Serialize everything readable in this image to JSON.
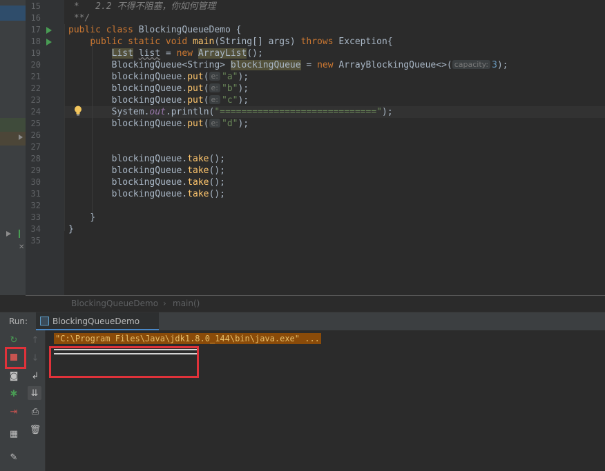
{
  "editor": {
    "line_numbers": [
      "15",
      "16",
      "17",
      "18",
      "19",
      "20",
      "21",
      "22",
      "23",
      "24",
      "25",
      "26",
      "27",
      "28",
      "29",
      "30",
      "31",
      "32",
      "33",
      "34",
      "35"
    ],
    "comment_line_1": " *   2.2 不得不阻塞，你如何管理",
    "comment_line_2": " **/",
    "class_decl": {
      "kw": "public class ",
      "name": "BlockingQueueDemo",
      "brace": " {"
    },
    "main_decl": {
      "kw1": "public static void ",
      "name": "main",
      "params": "(String[] args) ",
      "throws": "throws ",
      "exc": "Exception",
      "brace": "{"
    },
    "line19": {
      "type": "List",
      "sp": " ",
      "var": "list",
      "eq": " = ",
      "new": "new ",
      "cls": "ArrayList",
      "end": "();"
    },
    "line20": {
      "type": "BlockingQueue",
      "gen": "<String>",
      "sp": " ",
      "var": "blockingQueue",
      "eq": " = ",
      "new": "new ",
      "cls": "ArrayBlockingQueue",
      "gen2": "<>(",
      "hint": "capacity:",
      "num": "3",
      "end": ");"
    },
    "line21": {
      "obj": "blockingQueue",
      "dot": ".",
      "m": "put",
      "open": "(",
      "hint": "e:",
      "arg": "\"a\"",
      "end": ");"
    },
    "line22": {
      "obj": "blockingQueue",
      "dot": ".",
      "m": "put",
      "open": "(",
      "hint": "e:",
      "arg": "\"b\"",
      "end": ");"
    },
    "line23": {
      "obj": "blockingQueue",
      "dot": ".",
      "m": "put",
      "open": "(",
      "hint": "e:",
      "arg": "\"c\"",
      "end": ");"
    },
    "line24": {
      "sys": "System",
      "dot": ".",
      "out": "out",
      "dot2": ".",
      "m": "println",
      "open": "(",
      "arg": "\"=============================\"",
      "end": ");"
    },
    "line25": {
      "obj": "blockingQueue",
      "dot": ".",
      "m": "put",
      "open": "(",
      "hint": "e:",
      "arg": "\"d\"",
      "end": ");"
    },
    "take_lines": [
      {
        "obj": "blockingQueue",
        "dot": ".",
        "m": "take",
        "end": "();"
      },
      {
        "obj": "blockingQueue",
        "dot": ".",
        "m": "take",
        "end": "();"
      },
      {
        "obj": "blockingQueue",
        "dot": ".",
        "m": "take",
        "end": "();"
      },
      {
        "obj": "blockingQueue",
        "dot": ".",
        "m": "take",
        "end": "();"
      }
    ],
    "close_brace_inner": "}",
    "close_brace_outer": "}"
  },
  "breadcrumb": {
    "class": "BlockingQueueDemo",
    "sep": "›",
    "method": "main()"
  },
  "run_panel": {
    "label": "Run:",
    "tab_label": "BlockingQueueDemo",
    "tab_settings": "×",
    "console_command": "\"C:\\Program Files\\Java\\jdk1.8.0_144\\bin\\java.exe\" ..."
  },
  "icons": {
    "rerun": "rerun-icon",
    "stop": "stop-icon",
    "screenshot": "camera-icon",
    "debug": "bug-icon",
    "exit": "exit-icon",
    "layout": "layout-icon",
    "pin": "pin-icon",
    "up": "arrow-up-icon",
    "down": "arrow-down-icon",
    "wrap": "soft-wrap-icon",
    "scroll": "scroll-to-end-icon",
    "print": "print-icon",
    "trash": "trash-icon",
    "bulb": "lightbulb-icon"
  },
  "colors": {
    "keyword": "#cc7832",
    "string": "#6a8759",
    "annotation_box": "#e0323a",
    "console_cmd_bg": "#8a4b09"
  }
}
